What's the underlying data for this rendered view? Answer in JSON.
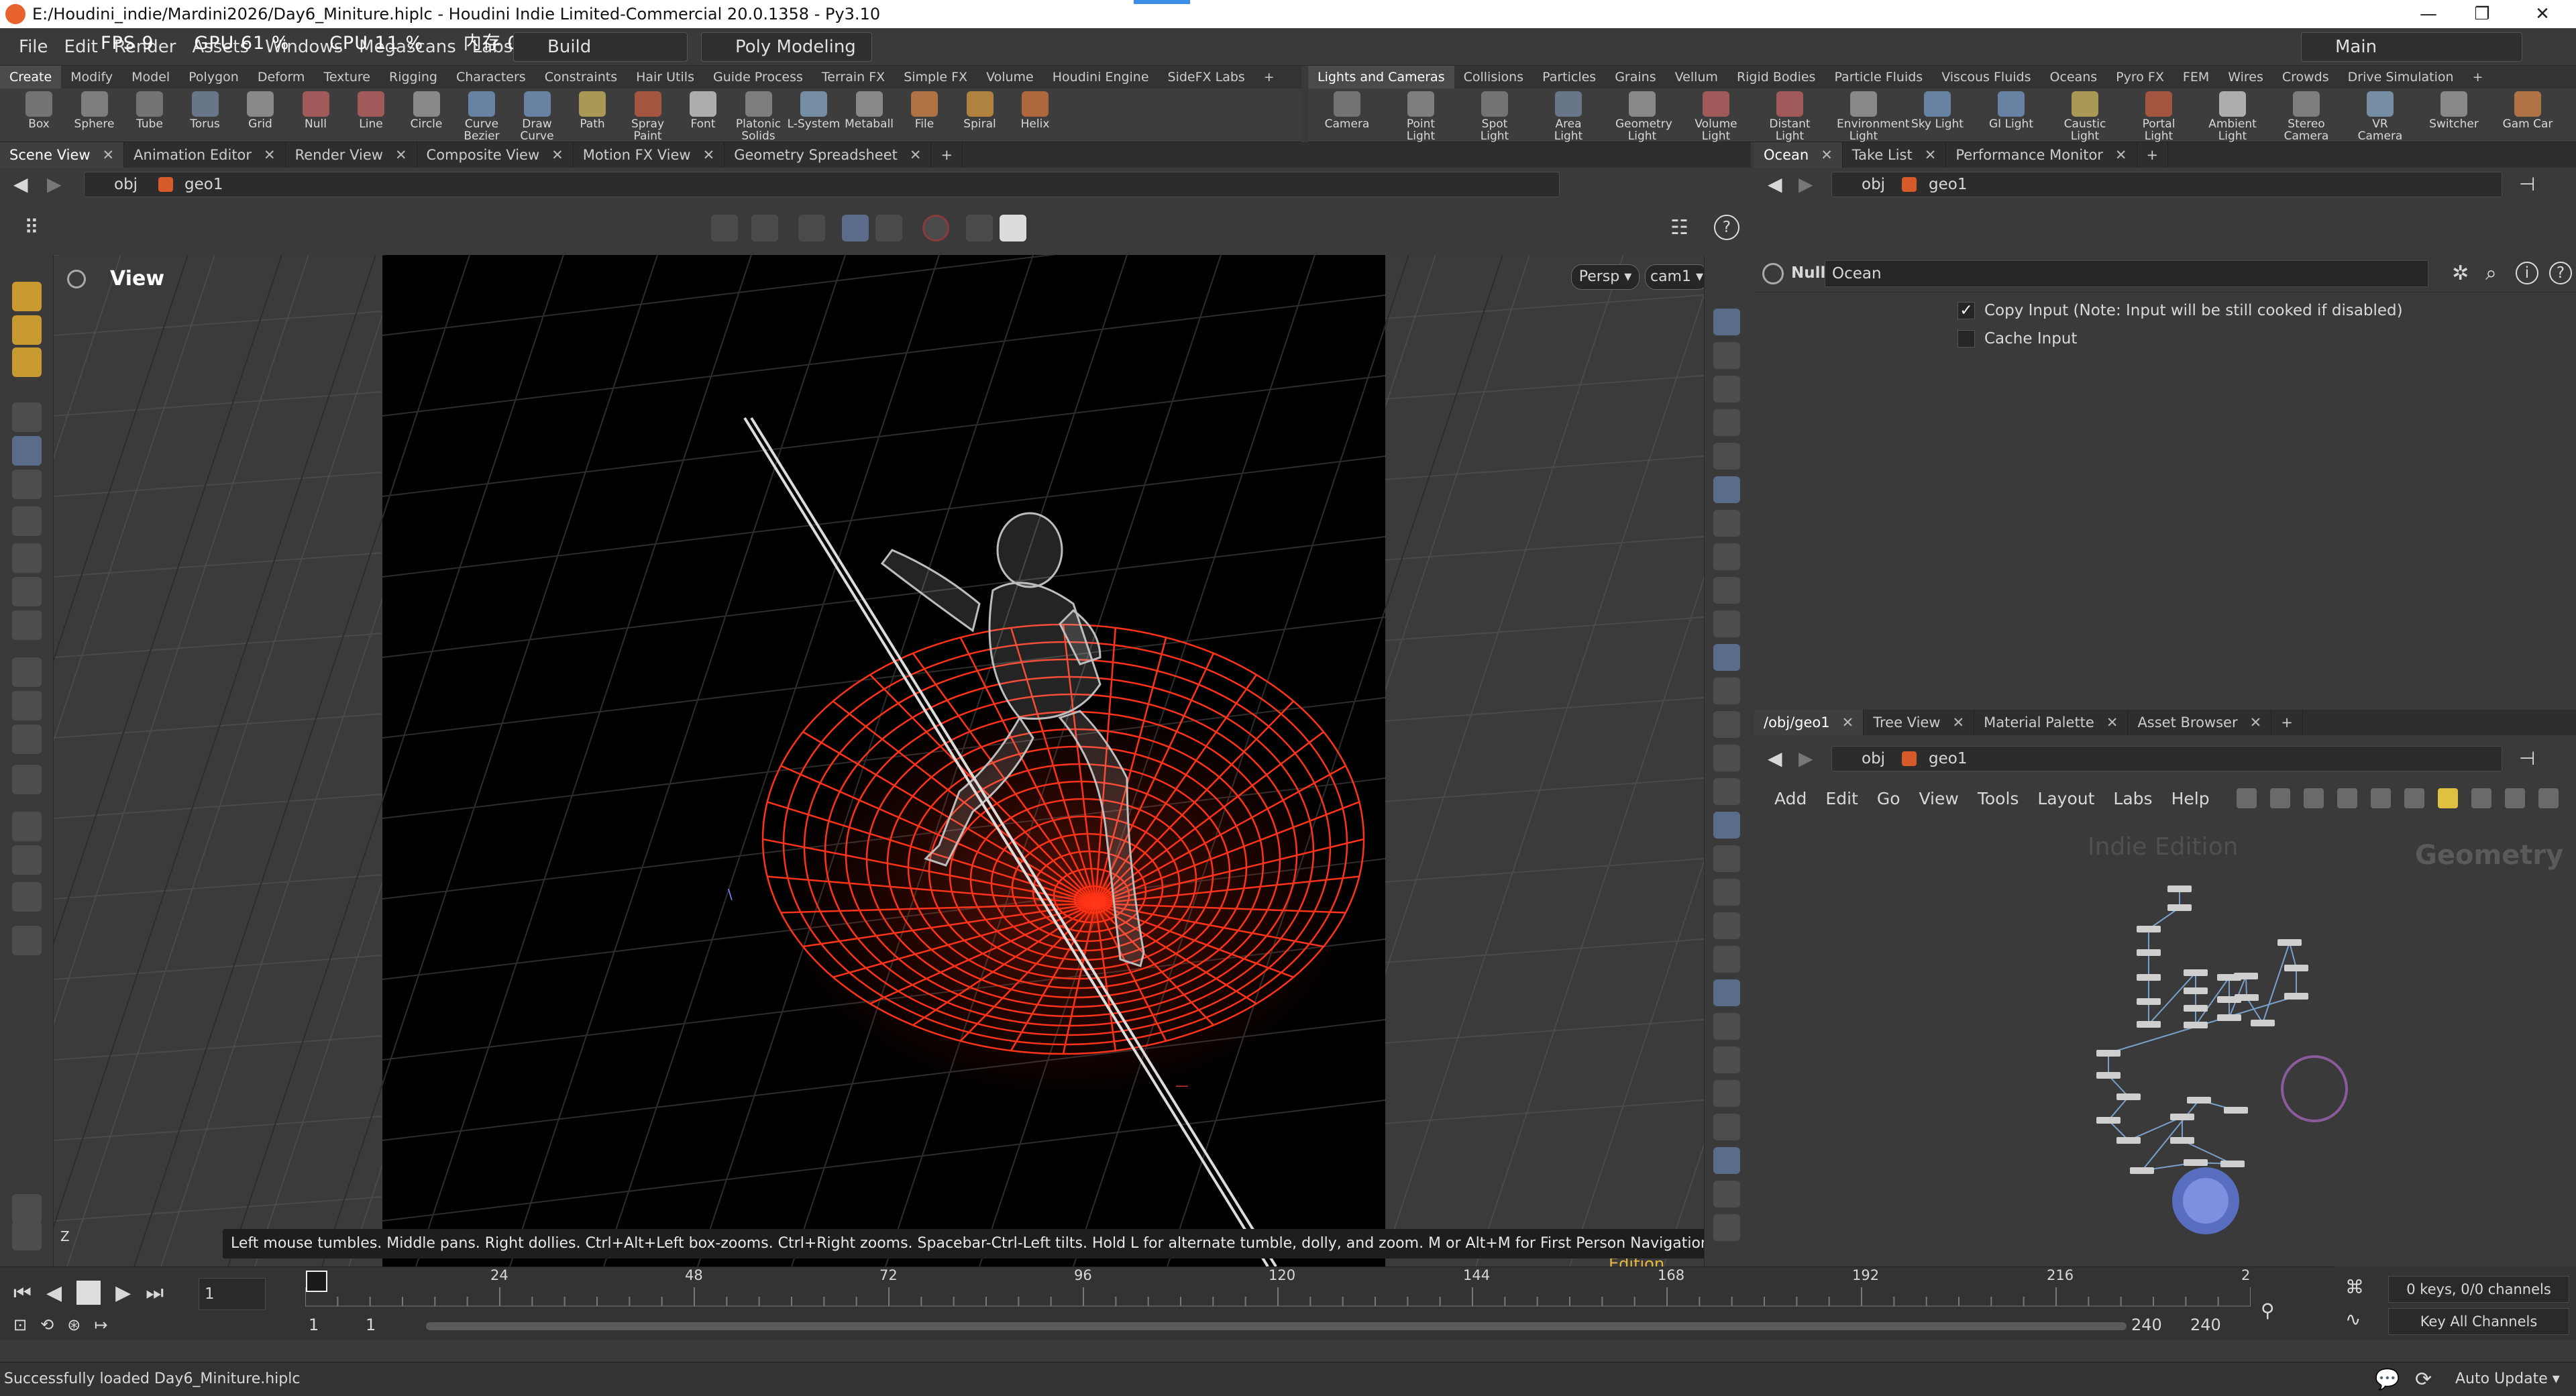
{
  "titlebar": {
    "title": "E:/Houdini_indie/Mardini2026/Day6_Miniture.hiplc - Houdini Indie Limited-Commercial 20.0.1358 - Py3.10",
    "minimize": "—",
    "maximize": "❐",
    "close": "✕"
  },
  "menubar": {
    "items": [
      "File",
      "Edit",
      "Render",
      "Assets",
      "Windows",
      "Megascans",
      "Labs",
      "Help"
    ],
    "perf": {
      "fps": "FPS   9",
      "gpu": "GPU 61 %",
      "cpu": "CPU 11 %",
      "mem": "内存  0.5 GB"
    },
    "build": "Build",
    "desktop": "Poly Modeling",
    "main": "Main"
  },
  "shelf_left": {
    "tabs": [
      "Create",
      "Modify",
      "Model",
      "Polygon",
      "Deform",
      "Texture",
      "Rigging",
      "Characters",
      "Constraints",
      "Hair Utils",
      "Guide Process",
      "Terrain FX",
      "Simple FX",
      "Volume",
      "Houdini Engine",
      "SideFX Labs"
    ],
    "tools": [
      "Box",
      "Sphere",
      "Tube",
      "Torus",
      "Grid",
      "Null",
      "Line",
      "Circle",
      "Curve Bezier",
      "Draw Curve",
      "Path",
      "Spray Paint",
      "Font",
      "Platonic Solids",
      "L-System",
      "Metaball",
      "File",
      "Spiral",
      "Helix"
    ]
  },
  "shelf_right": {
    "tabs": [
      "Lights and Cameras",
      "Collisions",
      "Particles",
      "Grains",
      "Vellum",
      "Rigid Bodies",
      "Particle Fluids",
      "Viscous Fluids",
      "Oceans",
      "Pyro FX",
      "FEM",
      "Wires",
      "Crowds",
      "Drive Simulation"
    ],
    "tools": [
      "Camera",
      "Point Light",
      "Spot Light",
      "Area Light",
      "Geometry Light",
      "Volume Light",
      "Distant Light",
      "Environment Light",
      "Sky Light",
      "GI Light",
      "Caustic Light",
      "Portal Light",
      "Ambient Light",
      "Stereo Camera",
      "VR Camera",
      "Switcher",
      "Gam Car"
    ]
  },
  "viewer": {
    "tabs": [
      "Scene View",
      "Animation Editor",
      "Render View",
      "Composite View",
      "Motion FX View",
      "Geometry Spreadsheet"
    ],
    "path_obj": "obj",
    "path_geo": "geo1",
    "view_label": "View",
    "persp": "Persp",
    "cam": "cam1",
    "hint": "Left mouse tumbles. Middle pans. Right dollies. Ctrl+Alt+Left box-zooms. Ctrl+Right zooms. Spacebar-Ctrl-Left tilts. Hold L for alternate tumble, dolly, and zoom. M or Alt+M for First Person Navigation.",
    "edition": "Indie Edition"
  },
  "params": {
    "tabs": [
      "Ocean",
      "Take List",
      "Performance Monitor"
    ],
    "path_obj": "obj",
    "path_geo": "geo1",
    "node_type": "Null",
    "node_name": "Ocean",
    "copy_input": "Copy Input (Note: Input will be still cooked if disabled)",
    "cache_input": "Cache Input"
  },
  "network": {
    "tabs": [
      "/obj/geo1",
      "Tree View",
      "Material Palette",
      "Asset Browser"
    ],
    "path_obj": "obj",
    "path_geo": "geo1",
    "menu": [
      "Add",
      "Edit",
      "Go",
      "View",
      "Tools",
      "Layout",
      "Labs",
      "Help"
    ],
    "watermark": "Indie Edition",
    "context": "Geometry"
  },
  "timeline": {
    "ticks": [
      "24",
      "48",
      "72",
      "96",
      "120",
      "144",
      "168",
      "192",
      "216",
      "2"
    ],
    "current_frame": "1",
    "start1": "1",
    "start2": "1",
    "end1": "240",
    "end2": "240",
    "keys_info": "0 keys, 0/0 channels",
    "key_all": "Key All Channels"
  },
  "status": {
    "message": "Successfully loaded Day6_Miniture.hiplc",
    "auto_update": "Auto Update"
  }
}
